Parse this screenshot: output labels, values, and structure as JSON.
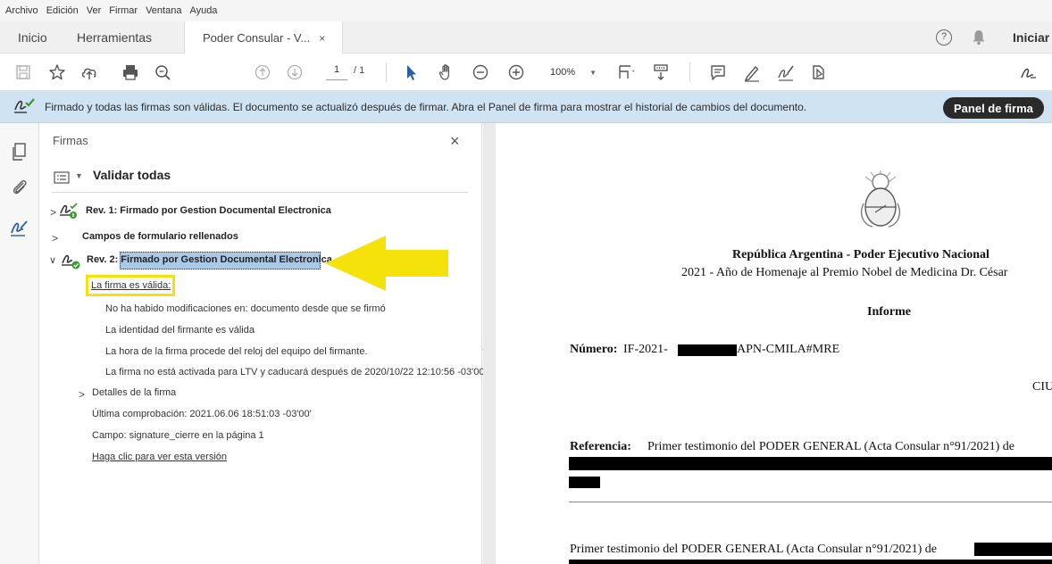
{
  "menu": [
    "Archivo",
    "Edición",
    "Ver",
    "Firmar",
    "Ventana",
    "Ayuda"
  ],
  "tabs": {
    "home": "Inicio",
    "tools": "Herramientas",
    "document": "Poder Consular - V...",
    "close": "×",
    "signin": "Iniciar"
  },
  "toolbar": {
    "page_current": "1",
    "page_total": "/ 1",
    "zoom": "100%"
  },
  "notice": {
    "message": "Firmado y todas las firmas son válidas. El documento se actualizó después de firmar. Abra el Panel de firma para mostrar el historial de cambios del documento.",
    "panel_button": "Panel de firma"
  },
  "signatures": {
    "title": "Firmas",
    "close": "×",
    "validate_all": "Validar todas",
    "rev1": "Rev. 1: Firmado por Gestion Documental Electronica",
    "form_fields": "Campos de formulario rellenados",
    "rev2": "Rev. 2: Firmado por Gestion Documental Electronica",
    "valid": "La firma es válida:",
    "details": [
      "No ha habido modificaciones en: documento desde que se firmó",
      "La identidad del firmante es válida",
      "La hora de la firma procede del reloj del equipo del firmante.",
      "La firma no está activada para LTV y caducará después de 2020/10/22 12:10:56 -03'00'"
    ],
    "signature_details": "Detalles de la firma",
    "last_check": "Última comprobación: 2021.06.06 18:51:03 -03'00'",
    "field": "Campo: signature_cierre en la página 1",
    "view_version": "Haga clic para ver esta versión"
  },
  "document": {
    "header1": "República Argentina - Poder Ejecutivo Nacional",
    "header2": "2021 - Año de Homenaje al Premio Nobel de Medicina Dr. César",
    "heading": "Informe",
    "number_label": "Número:",
    "number_prefix": "IF-2021-",
    "number_suffix": "APN-CMILA#MRE",
    "city": "CIU",
    "reference_label": "Referencia:",
    "reference_text": "Primer testimonio del PODER GENERAL (Acta Consular n°91/2021) de",
    "body_text": "Primer testimonio del PODER GENERAL (Acta Consular n°91/2021) de"
  },
  "colors": {
    "notice_bg": "#cfe3f3",
    "highlight_yellow": "#f4e20a",
    "selection_blue": "#a9c9e6",
    "valid_green": "#3a9b2f"
  }
}
